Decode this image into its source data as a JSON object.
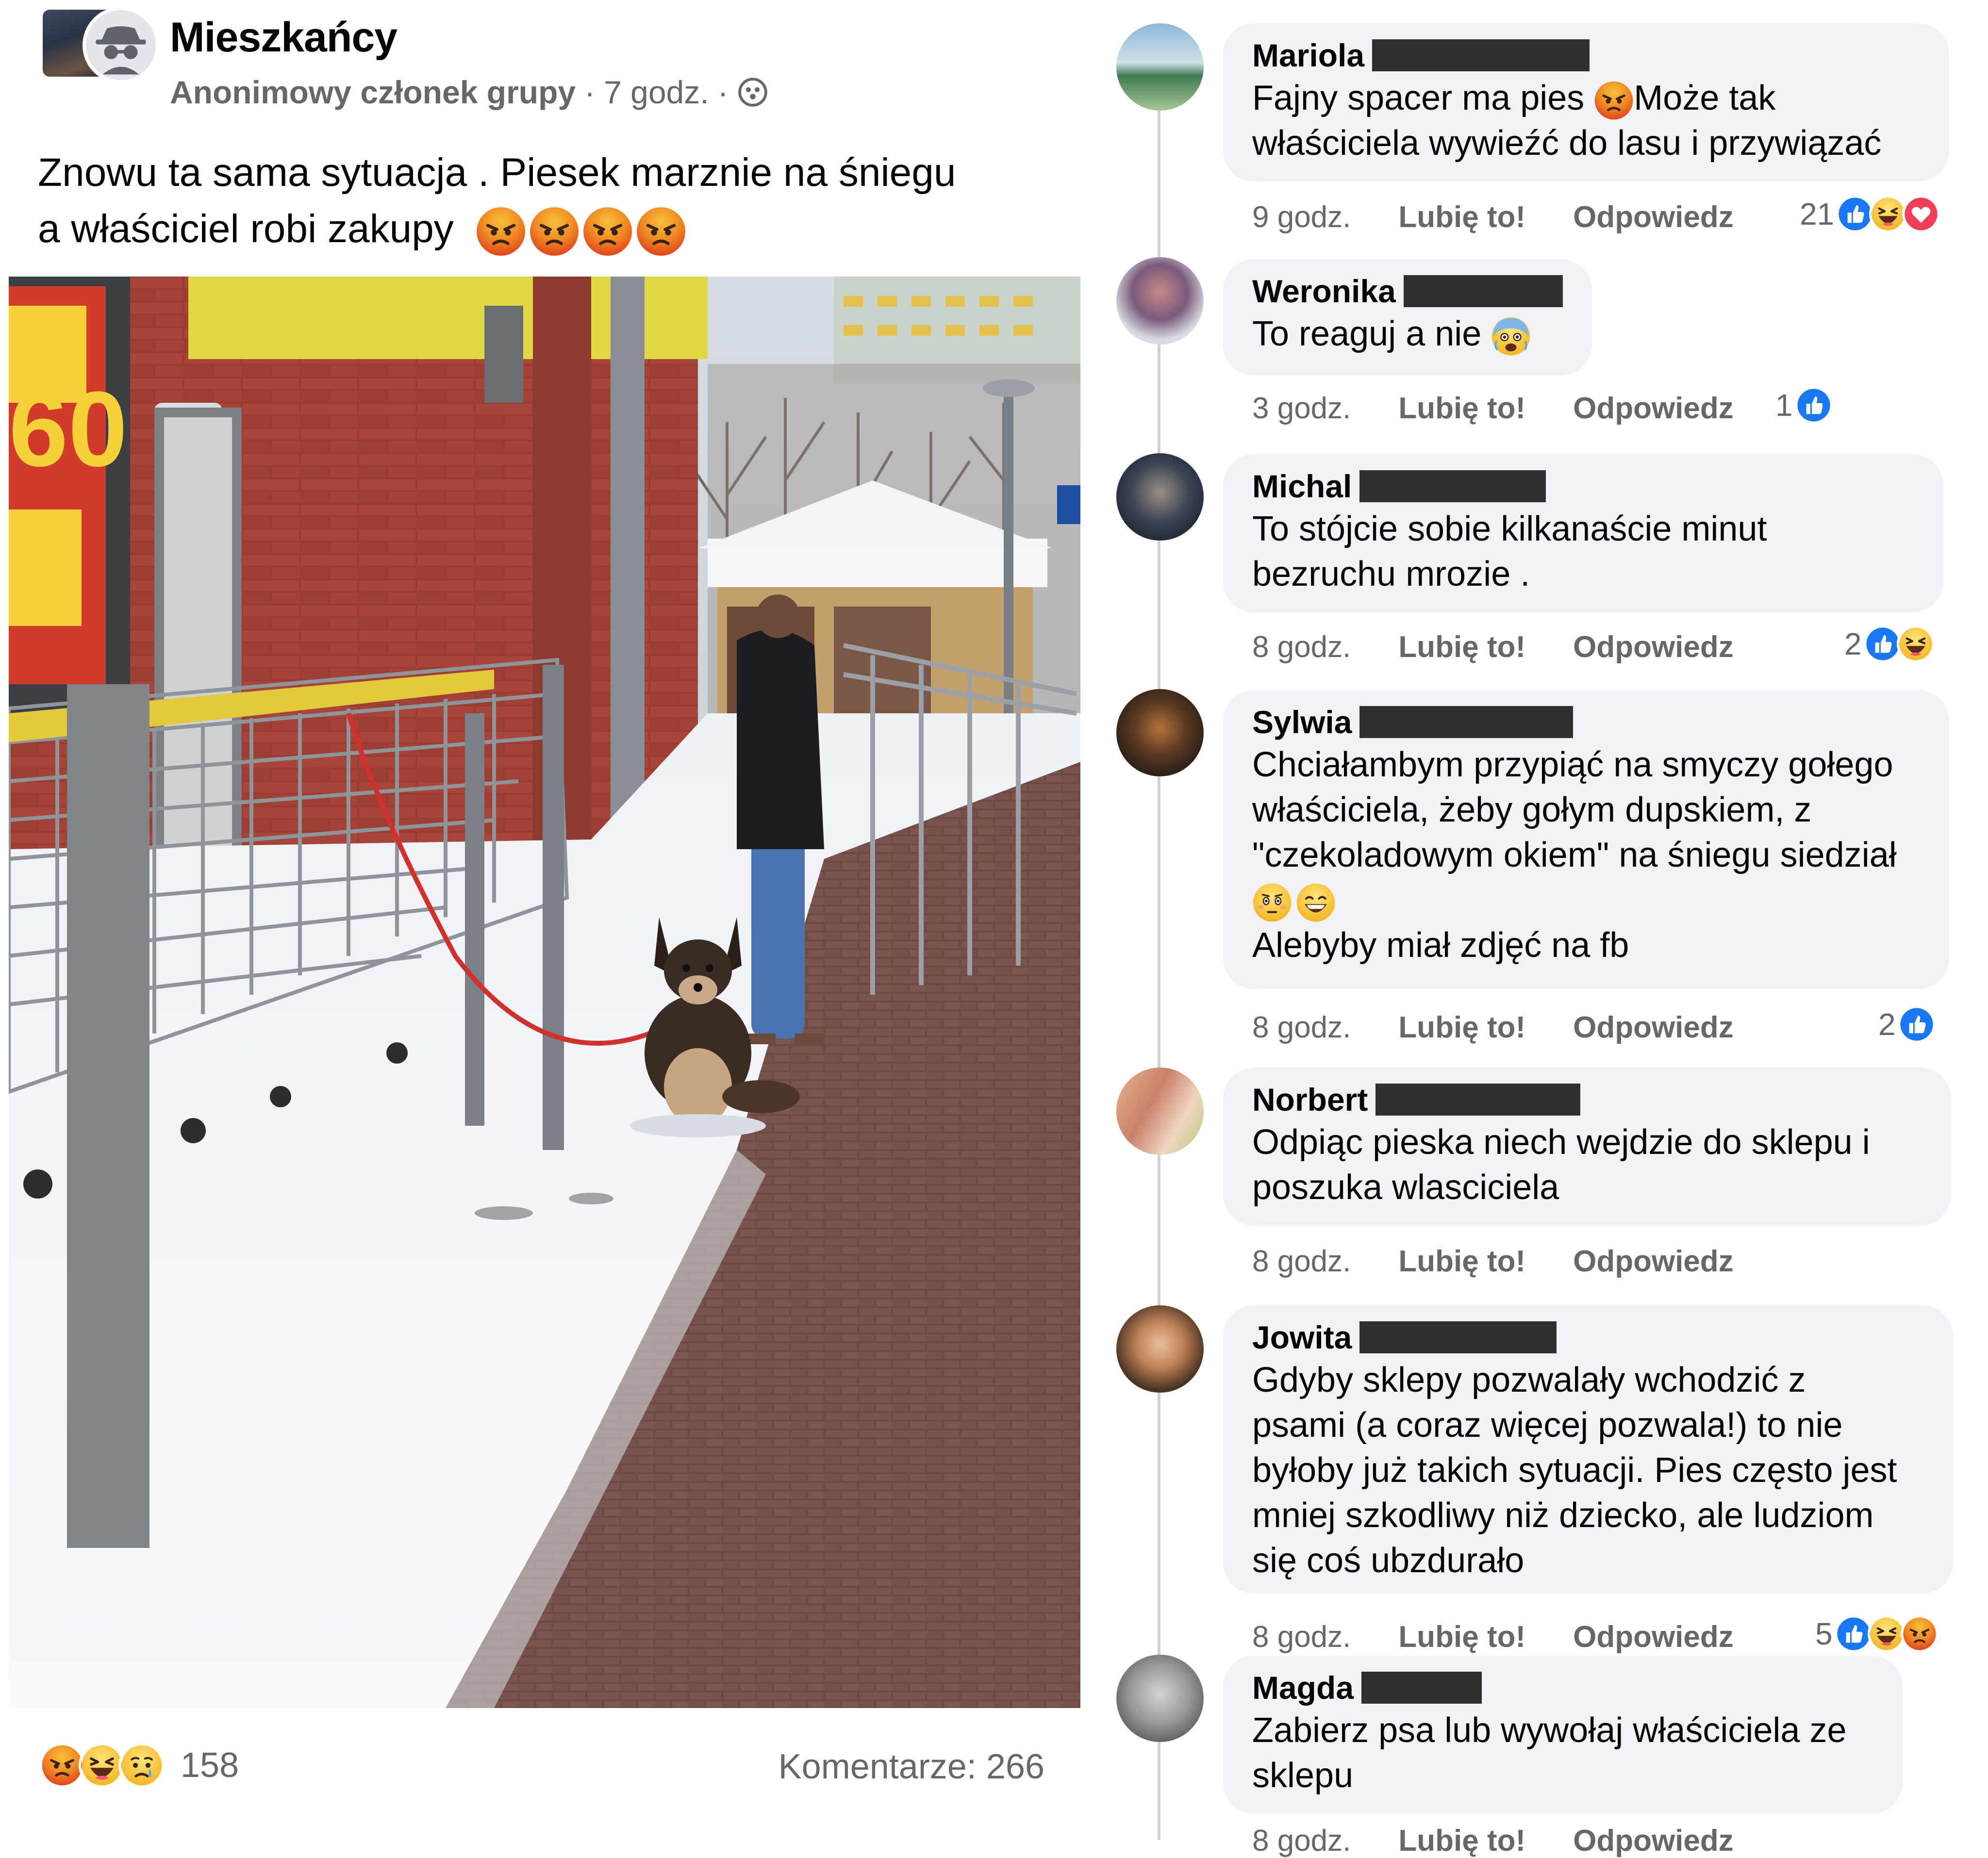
{
  "post": {
    "group_name": "Mieszkańcy",
    "author": "Anonimowy członek grupy",
    "time": "7 godz.",
    "separator": "·",
    "text_line1": "Znowu ta sama sytuacja . Piesek marznie na śniegu",
    "text_line2": "a właściciel robi zakupy",
    "text_emojis": [
      "angry-face",
      "angry-face",
      "angry-face",
      "angry-face"
    ],
    "privacy_icon": "group-members-icon",
    "photo_description_icon": "photo",
    "reactions": [
      "angry",
      "haha",
      "sad"
    ],
    "reaction_count": "158",
    "comments_count": "Komentarze: 266"
  },
  "comments": [
    {
      "name": "Mariola",
      "text": [
        "Fajny spacer ma pies ",
        "Może tak",
        "właściciela wywieźć do lasu i przywiązać"
      ],
      "inline_emoji": "angry-face",
      "time": "9 godz.",
      "like": "Lubię to!",
      "reply": "Odpowiedz",
      "reaction_count": "21",
      "reactions": [
        "like",
        "haha",
        "love"
      ]
    },
    {
      "name": "Weronika",
      "text": [
        "To reaguj a nie "
      ],
      "inline_emoji": "scared-face",
      "time": "3 godz.",
      "like": "Lubię to!",
      "reply": "Odpowiedz",
      "reaction_count": "1",
      "reactions": [
        "like"
      ]
    },
    {
      "name": "Michal",
      "text": [
        "To stójcie sobie kilkanaście minut",
        "bezruchu mrozie ."
      ],
      "time": "8 godz.",
      "like": "Lubię to!",
      "reply": "Odpowiedz",
      "reaction_count": "2",
      "reactions": [
        "like",
        "haha"
      ]
    },
    {
      "name": "Sylwia",
      "text": [
        "Chciałambym przypiąć na smyczy gołego",
        "właściciela, żeby gołym dupskiem, z",
        "\"czekoladowym okiem\" na śniegu siedział",
        "Alebyby miał zdjęć na fb"
      ],
      "emoji_line": [
        "flushed-face",
        "grinning-face"
      ],
      "time": "8 godz.",
      "like": "Lubię to!",
      "reply": "Odpowiedz",
      "reaction_count": "2",
      "reactions": [
        "like"
      ]
    },
    {
      "name": "Norbert",
      "text": [
        "Odpiąc pieska niech wejdzie do sklepu i",
        "poszuka wlasciciela"
      ],
      "time": "8 godz.",
      "like": "Lubię to!",
      "reply": "Odpowiedz"
    },
    {
      "name": "Jowita",
      "text": [
        "Gdyby sklepy pozwalały wchodzić z",
        "psami (a coraz więcej pozwala!) to nie",
        "byłoby już takich sytuacji. Pies często jest",
        "mniej szkodliwy niż dziecko, ale ludziom",
        "się coś ubzdurało"
      ],
      "time": "8 godz.",
      "like": "Lubię to!",
      "reply": "Odpowiedz",
      "reaction_count": "5",
      "reactions": [
        "like",
        "haha",
        "angry"
      ]
    },
    {
      "name": "Magda",
      "text": [
        "Zabierz psa lub wywołaj właściciela ze",
        "sklepu"
      ],
      "time": "8 godz.",
      "like": "Lubię to!",
      "reply": "Odpowiedz"
    }
  ],
  "colors": {
    "like_blue": "#1877f2",
    "angry": "#e9710f",
    "haha": "#f7b125",
    "love": "#f33e58",
    "bubble_bg": "#f0f2f5",
    "meta_gray": "#65676b"
  }
}
